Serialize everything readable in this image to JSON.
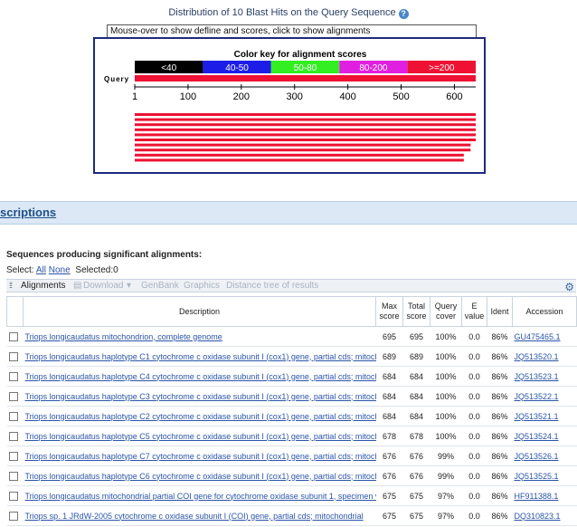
{
  "graphic": {
    "title": "Distribution of 10 Blast Hits on the Query Sequence",
    "defline_prompt": "Mouse-over to show defline and scores, click to show alignments",
    "color_key_title": "Color key for alignment scores",
    "color_key": [
      {
        "label": "<40",
        "color": "#000000",
        "text_color": "#ffffff"
      },
      {
        "label": "40-50",
        "color": "#1d1de8",
        "text_color": "#ffffff"
      },
      {
        "label": "50-80",
        "color": "#33ee22",
        "text_color": "#ffffff"
      },
      {
        "label": "80-200",
        "color": "#e020e0",
        "text_color": "#ffffff"
      },
      {
        "label": ">=200",
        "color": "#ee1133",
        "text_color": "#ffffff"
      }
    ],
    "query_label": "Query",
    "query_length": 640,
    "ticks": [
      "1",
      "100",
      "200",
      "300",
      "400",
      "500",
      "600"
    ],
    "hit_bar_color": "#ee1133",
    "hit_cover_pct": [
      100,
      100,
      100,
      100,
      100,
      100,
      99,
      99,
      97,
      97
    ]
  },
  "descriptions_section": {
    "label": "scriptions"
  },
  "sequences": {
    "title": "Sequences producing significant alignments:",
    "select_label": "Select:",
    "select_all": "All",
    "select_none": "None",
    "selected": "Selected:0"
  },
  "toolbar": {
    "alignments": "Alignments",
    "download": "Download",
    "genbank": "GenBank",
    "graphics": "Graphics",
    "distance_tree": "Distance tree of results"
  },
  "table": {
    "headers": {
      "description": "Description",
      "max_score": [
        "Max",
        "score"
      ],
      "total_score": [
        "Total",
        "score"
      ],
      "query_cover": [
        "Query",
        "cover"
      ],
      "e_value": [
        "E",
        "value"
      ],
      "ident": "Ident",
      "accession": "Accession"
    },
    "rows": [
      {
        "description": "Triops longicaudatus mitochondrion, complete genome",
        "max": "695",
        "total": "695",
        "cover": "100%",
        "e": "0.0",
        "ident": "86%",
        "accession": "GU475465.1"
      },
      {
        "description": "Triops longicaudatus haplotype C1 cytochrome c oxidase subunit I (cox1) gene, partial cds; mitoch",
        "max": "689",
        "total": "689",
        "cover": "100%",
        "e": "0.0",
        "ident": "86%",
        "accession": "JQ513520.1"
      },
      {
        "description": "Triops longicaudatus haplotype C4 cytochrome c oxidase subunit I (cox1) gene, partial cds; mitoch",
        "max": "684",
        "total": "684",
        "cover": "100%",
        "e": "0.0",
        "ident": "86%",
        "accession": "JQ513523.1"
      },
      {
        "description": "Triops longicaudatus haplotype C3 cytochrome c oxidase subunit I (cox1) gene, partial cds; mitoch",
        "max": "684",
        "total": "684",
        "cover": "100%",
        "e": "0.0",
        "ident": "86%",
        "accession": "JQ513522.1"
      },
      {
        "description": "Triops longicaudatus haplotype C2 cytochrome c oxidase subunit I (cox1) gene, partial cds; mitoch",
        "max": "684",
        "total": "684",
        "cover": "100%",
        "e": "0.0",
        "ident": "86%",
        "accession": "JQ513521.1"
      },
      {
        "description": "Triops longicaudatus haplotype C5 cytochrome c oxidase subunit I (cox1) gene, partial cds; mitoch",
        "max": "678",
        "total": "678",
        "cover": "100%",
        "e": "0.0",
        "ident": "86%",
        "accession": "JQ513524.1"
      },
      {
        "description": "Triops longicaudatus haplotype C7 cytochrome c oxidase subunit I (cox1) gene, partial cds; mitoch",
        "max": "676",
        "total": "676",
        "cover": "99%",
        "e": "0.0",
        "ident": "86%",
        "accession": "JQ513526.1"
      },
      {
        "description": "Triops longicaudatus haplotype C6 cytochrome c oxidase subunit I (cox1) gene, partial cds; mitoch",
        "max": "676",
        "total": "676",
        "cover": "99%",
        "e": "0.0",
        "ident": "86%",
        "accession": "JQ513525.1"
      },
      {
        "description": "Triops longicaudatus mitochondrial partial COI gene for cytochrome oxidase subunit 1, specimen v",
        "max": "675",
        "total": "675",
        "cover": "97%",
        "e": "0.0",
        "ident": "86%",
        "accession": "HF911388.1"
      },
      {
        "description": "Triops sp. 1 JRdW-2005 cytochrome c oxidase subunit I (COI) gene, partial cds; mitochondrial",
        "max": "675",
        "total": "675",
        "cover": "97%",
        "e": "0.0",
        "ident": "86%",
        "accession": "DQ310823.1"
      }
    ]
  }
}
